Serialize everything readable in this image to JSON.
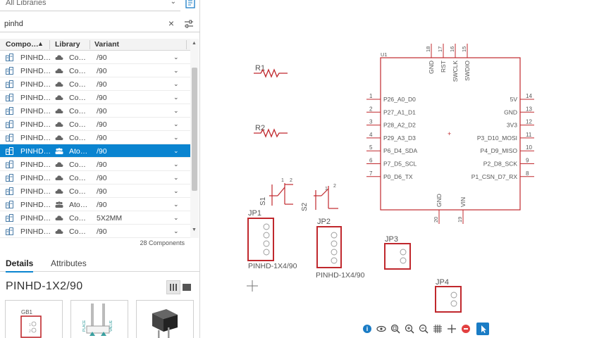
{
  "library_filter": {
    "value": "All Libraries"
  },
  "search": {
    "value": "pinhd"
  },
  "table": {
    "headers": [
      "Compo…",
      "Library",
      "Variant"
    ],
    "rows": [
      {
        "name": "PINHD…",
        "library": "Co…",
        "variant": "/90",
        "icon": "cloud-library-icon",
        "selected": false
      },
      {
        "name": "PINHD…",
        "library": "Co…",
        "variant": "/90",
        "icon": "cloud-library-icon",
        "selected": false
      },
      {
        "name": "PINHD…",
        "library": "Co…",
        "variant": "/90",
        "icon": "cloud-library-icon",
        "selected": false
      },
      {
        "name": "PINHD…",
        "library": "Co…",
        "variant": "/90",
        "icon": "cloud-library-icon",
        "selected": false
      },
      {
        "name": "PINHD…",
        "library": "Co…",
        "variant": "/90",
        "icon": "cloud-library-icon",
        "selected": false
      },
      {
        "name": "PINHD…",
        "library": "Co…",
        "variant": "/90",
        "icon": "cloud-library-icon",
        "selected": false
      },
      {
        "name": "PINHD…",
        "library": "Co…",
        "variant": "/90",
        "icon": "cloud-library-icon",
        "selected": false
      },
      {
        "name": "PINHD…",
        "library": "Ato…",
        "variant": "/90",
        "icon": "team-library-icon",
        "selected": true
      },
      {
        "name": "PINHD…",
        "library": "Co…",
        "variant": "/90",
        "icon": "cloud-library-icon",
        "selected": false
      },
      {
        "name": "PINHD…",
        "library": "Co…",
        "variant": "/90",
        "icon": "cloud-library-icon",
        "selected": false
      },
      {
        "name": "PINHD…",
        "library": "Co…",
        "variant": "/90",
        "icon": "cloud-library-icon",
        "selected": false
      },
      {
        "name": "PINHD…",
        "library": "Ato…",
        "variant": "/90",
        "icon": "team-library-icon",
        "selected": false
      },
      {
        "name": "PINHD…",
        "library": "Co…",
        "variant": "5X2MM",
        "icon": "cloud-library-icon",
        "selected": false
      },
      {
        "name": "PINHD…",
        "library": "Co…",
        "variant": "/90",
        "icon": "cloud-library-icon",
        "selected": false
      }
    ],
    "count_label": "28 Components"
  },
  "tabs": [
    "Details",
    "Attributes"
  ],
  "details": {
    "title": "PINHD-1X2/90",
    "preview_label": "GB1"
  },
  "schematic": {
    "resistors": [
      "R1",
      "R2"
    ],
    "switches": [
      "S1",
      "S2"
    ],
    "headers": [
      {
        "name": "JP1",
        "value": "PINHD-1X4/90"
      },
      {
        "name": "JP2",
        "value": "PINHD-1X4/90"
      },
      {
        "name": "JP3",
        "value": ""
      },
      {
        "name": "JP4",
        "value": ""
      }
    ],
    "mcu": {
      "name": "U1",
      "left_pins": [
        {
          "num": "1",
          "label": "P26_A0_D0"
        },
        {
          "num": "2",
          "label": "P27_A1_D1"
        },
        {
          "num": "3",
          "label": "P28_A2_D2"
        },
        {
          "num": "4",
          "label": "P29_A3_D3"
        },
        {
          "num": "5",
          "label": "P6_D4_SDA"
        },
        {
          "num": "6",
          "label": "P7_D5_SCL"
        },
        {
          "num": "7",
          "label": "P0_D6_TX"
        }
      ],
      "right_pins": [
        {
          "num": "14",
          "label": "5V"
        },
        {
          "num": "13",
          "label": "GND"
        },
        {
          "num": "12",
          "label": "3V3"
        },
        {
          "num": "11",
          "label": "P3_D10_MOSI"
        },
        {
          "num": "10",
          "label": "P4_D9_MISO"
        },
        {
          "num": "9",
          "label": "P2_D8_SCK"
        },
        {
          "num": "8",
          "label": "P1_CSN_D7_RX"
        }
      ],
      "top_pins": [
        {
          "num": "18",
          "label": "GND"
        },
        {
          "num": "17",
          "label": "RST"
        },
        {
          "num": "16",
          "label": "SWCLK"
        },
        {
          "num": "15",
          "label": "SWDIO"
        }
      ],
      "bottom_pins": [
        {
          "num": "20",
          "label": "GND"
        },
        {
          "num": "19",
          "label": "VIN"
        }
      ]
    }
  },
  "colors": {
    "accent": "#0a84d0",
    "schematic_red": "#c0282d",
    "selection_row": "#0a84d0"
  }
}
